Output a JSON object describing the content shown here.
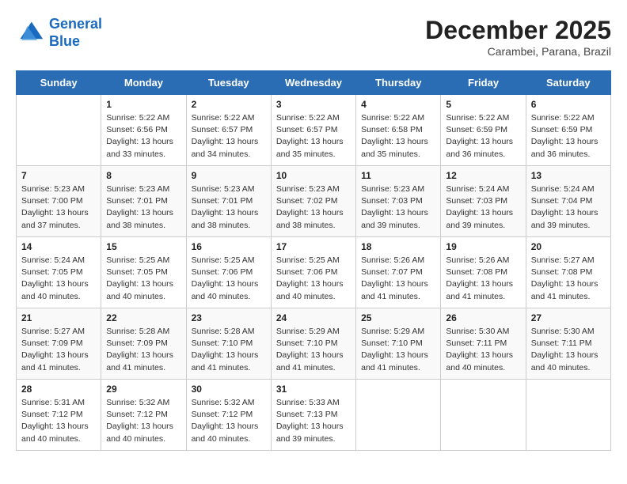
{
  "header": {
    "logo_line1": "General",
    "logo_line2": "Blue",
    "month": "December 2025",
    "location": "Carambei, Parana, Brazil"
  },
  "weekdays": [
    "Sunday",
    "Monday",
    "Tuesday",
    "Wednesday",
    "Thursday",
    "Friday",
    "Saturday"
  ],
  "weeks": [
    [
      {
        "day": "",
        "info": ""
      },
      {
        "day": "1",
        "info": "Sunrise: 5:22 AM\nSunset: 6:56 PM\nDaylight: 13 hours\nand 33 minutes."
      },
      {
        "day": "2",
        "info": "Sunrise: 5:22 AM\nSunset: 6:57 PM\nDaylight: 13 hours\nand 34 minutes."
      },
      {
        "day": "3",
        "info": "Sunrise: 5:22 AM\nSunset: 6:57 PM\nDaylight: 13 hours\nand 35 minutes."
      },
      {
        "day": "4",
        "info": "Sunrise: 5:22 AM\nSunset: 6:58 PM\nDaylight: 13 hours\nand 35 minutes."
      },
      {
        "day": "5",
        "info": "Sunrise: 5:22 AM\nSunset: 6:59 PM\nDaylight: 13 hours\nand 36 minutes."
      },
      {
        "day": "6",
        "info": "Sunrise: 5:22 AM\nSunset: 6:59 PM\nDaylight: 13 hours\nand 36 minutes."
      }
    ],
    [
      {
        "day": "7",
        "info": "Sunrise: 5:23 AM\nSunset: 7:00 PM\nDaylight: 13 hours\nand 37 minutes."
      },
      {
        "day": "8",
        "info": "Sunrise: 5:23 AM\nSunset: 7:01 PM\nDaylight: 13 hours\nand 38 minutes."
      },
      {
        "day": "9",
        "info": "Sunrise: 5:23 AM\nSunset: 7:01 PM\nDaylight: 13 hours\nand 38 minutes."
      },
      {
        "day": "10",
        "info": "Sunrise: 5:23 AM\nSunset: 7:02 PM\nDaylight: 13 hours\nand 38 minutes."
      },
      {
        "day": "11",
        "info": "Sunrise: 5:23 AM\nSunset: 7:03 PM\nDaylight: 13 hours\nand 39 minutes."
      },
      {
        "day": "12",
        "info": "Sunrise: 5:24 AM\nSunset: 7:03 PM\nDaylight: 13 hours\nand 39 minutes."
      },
      {
        "day": "13",
        "info": "Sunrise: 5:24 AM\nSunset: 7:04 PM\nDaylight: 13 hours\nand 39 minutes."
      }
    ],
    [
      {
        "day": "14",
        "info": "Sunrise: 5:24 AM\nSunset: 7:05 PM\nDaylight: 13 hours\nand 40 minutes."
      },
      {
        "day": "15",
        "info": "Sunrise: 5:25 AM\nSunset: 7:05 PM\nDaylight: 13 hours\nand 40 minutes."
      },
      {
        "day": "16",
        "info": "Sunrise: 5:25 AM\nSunset: 7:06 PM\nDaylight: 13 hours\nand 40 minutes."
      },
      {
        "day": "17",
        "info": "Sunrise: 5:25 AM\nSunset: 7:06 PM\nDaylight: 13 hours\nand 40 minutes."
      },
      {
        "day": "18",
        "info": "Sunrise: 5:26 AM\nSunset: 7:07 PM\nDaylight: 13 hours\nand 41 minutes."
      },
      {
        "day": "19",
        "info": "Sunrise: 5:26 AM\nSunset: 7:08 PM\nDaylight: 13 hours\nand 41 minutes."
      },
      {
        "day": "20",
        "info": "Sunrise: 5:27 AM\nSunset: 7:08 PM\nDaylight: 13 hours\nand 41 minutes."
      }
    ],
    [
      {
        "day": "21",
        "info": "Sunrise: 5:27 AM\nSunset: 7:09 PM\nDaylight: 13 hours\nand 41 minutes."
      },
      {
        "day": "22",
        "info": "Sunrise: 5:28 AM\nSunset: 7:09 PM\nDaylight: 13 hours\nand 41 minutes."
      },
      {
        "day": "23",
        "info": "Sunrise: 5:28 AM\nSunset: 7:10 PM\nDaylight: 13 hours\nand 41 minutes."
      },
      {
        "day": "24",
        "info": "Sunrise: 5:29 AM\nSunset: 7:10 PM\nDaylight: 13 hours\nand 41 minutes."
      },
      {
        "day": "25",
        "info": "Sunrise: 5:29 AM\nSunset: 7:10 PM\nDaylight: 13 hours\nand 41 minutes."
      },
      {
        "day": "26",
        "info": "Sunrise: 5:30 AM\nSunset: 7:11 PM\nDaylight: 13 hours\nand 40 minutes."
      },
      {
        "day": "27",
        "info": "Sunrise: 5:30 AM\nSunset: 7:11 PM\nDaylight: 13 hours\nand 40 minutes."
      }
    ],
    [
      {
        "day": "28",
        "info": "Sunrise: 5:31 AM\nSunset: 7:12 PM\nDaylight: 13 hours\nand 40 minutes."
      },
      {
        "day": "29",
        "info": "Sunrise: 5:32 AM\nSunset: 7:12 PM\nDaylight: 13 hours\nand 40 minutes."
      },
      {
        "day": "30",
        "info": "Sunrise: 5:32 AM\nSunset: 7:12 PM\nDaylight: 13 hours\nand 40 minutes."
      },
      {
        "day": "31",
        "info": "Sunrise: 5:33 AM\nSunset: 7:13 PM\nDaylight: 13 hours\nand 39 minutes."
      },
      {
        "day": "",
        "info": ""
      },
      {
        "day": "",
        "info": ""
      },
      {
        "day": "",
        "info": ""
      }
    ]
  ]
}
